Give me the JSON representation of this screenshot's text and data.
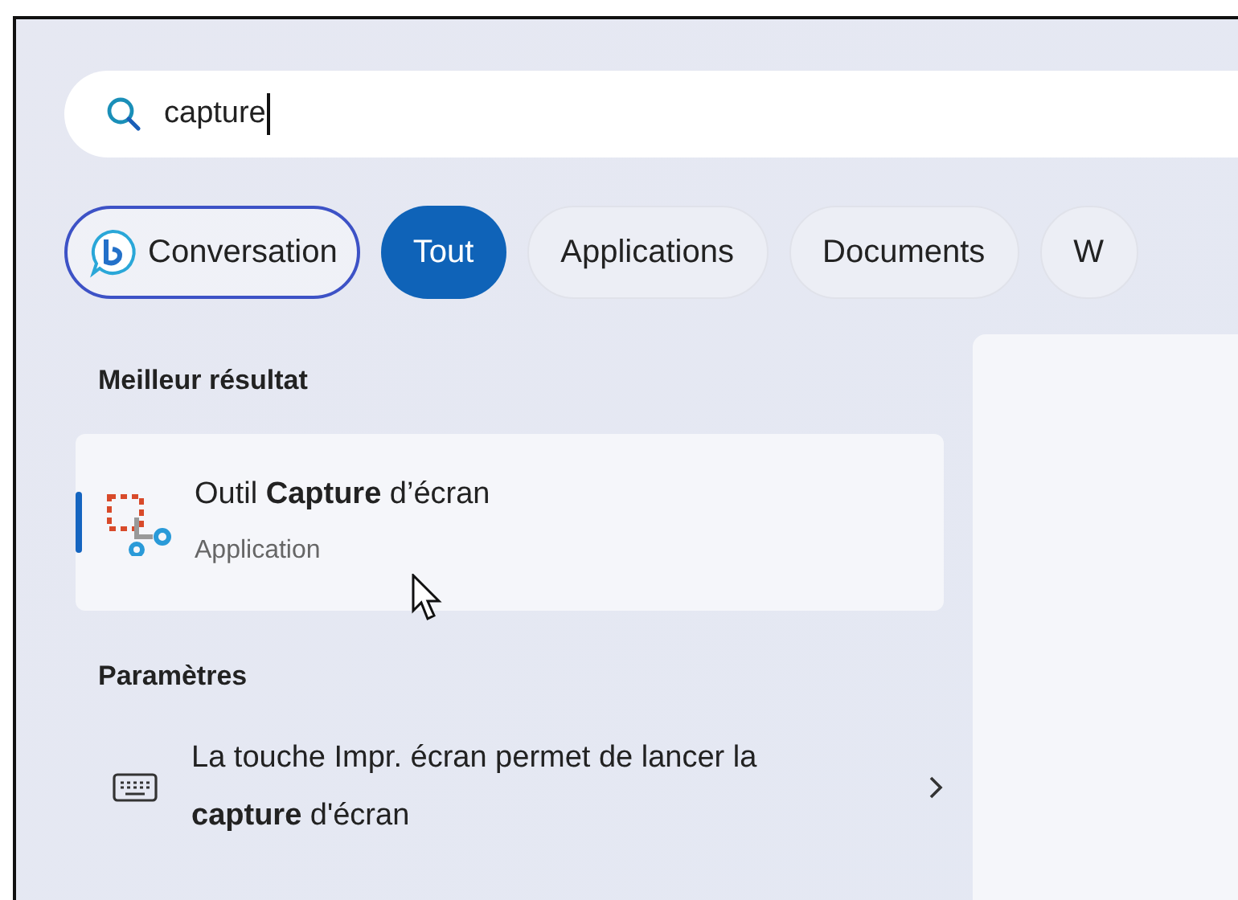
{
  "search": {
    "value": "capture"
  },
  "filters": [
    {
      "label": "Conversation",
      "kind": "chat",
      "selected": false
    },
    {
      "label": "Tout",
      "kind": "plain",
      "selected": true
    },
    {
      "label": "Applications",
      "kind": "plain",
      "selected": false
    },
    {
      "label": "Documents",
      "kind": "plain",
      "selected": false
    },
    {
      "label": "W",
      "kind": "plain",
      "selected": false
    }
  ],
  "best_result": {
    "heading": "Meilleur résultat",
    "item": {
      "title": "Outil **Capture** d’écran",
      "subtitle": "Application",
      "selected": true
    }
  },
  "settings": {
    "heading": "Paramètres",
    "items": [
      {
        "title": "La touche Impr. écran permet de lancer la **capture** d'écran"
      }
    ]
  }
}
